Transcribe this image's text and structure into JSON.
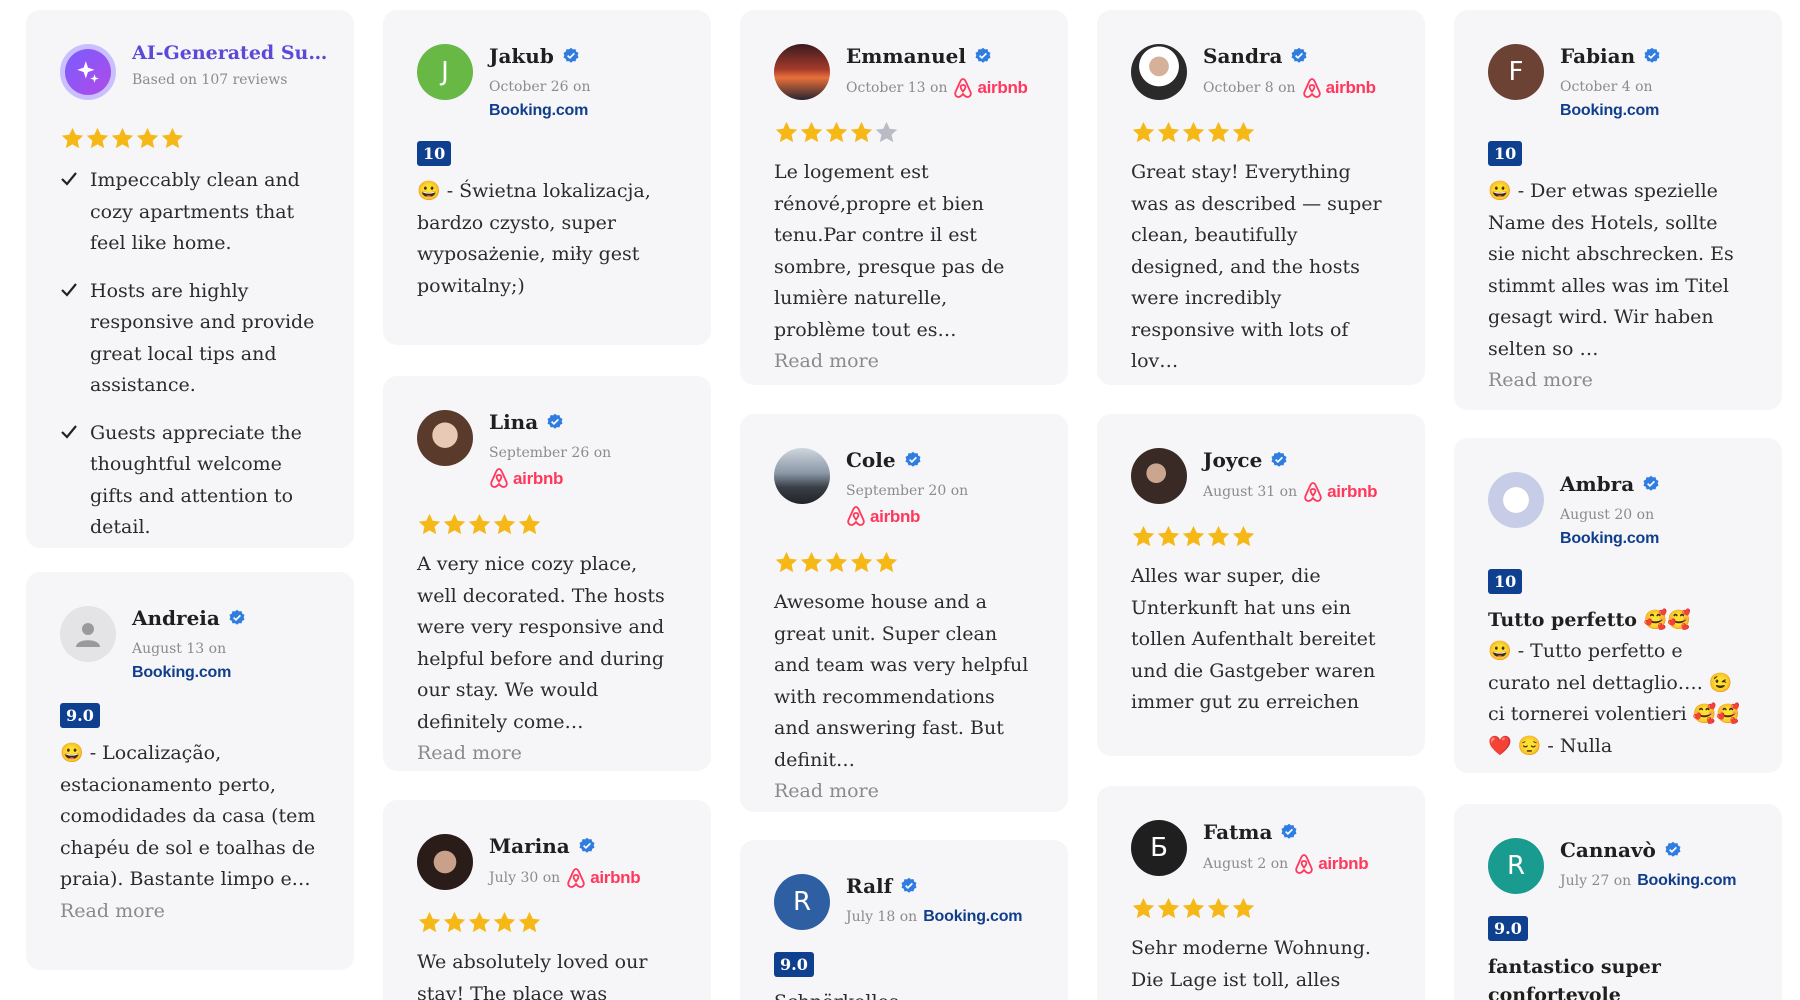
{
  "colors": {
    "star": "#f6b817",
    "star_empty": "#b9bcc4",
    "booking_navy": "#113e8c",
    "airbnb_red": "#ff385c",
    "score_bg": "#0f3f8f",
    "verified_blue": "#2f7de1",
    "ai_purple": "#5b49d8",
    "card_bg": "#f6f6f8"
  },
  "summary": {
    "title": "AI-Generated Summary",
    "subtitle": "Based on 107 reviews",
    "icon": "sparkle-icon",
    "stars": 5,
    "bullets": [
      "Impeccably clean and cozy apartments that feel like home.",
      "Hosts are highly responsive and provide great local tips and assistance.",
      "Guests appreciate the thoughtful welcome gifts and attention to detail."
    ]
  },
  "on_text": "on",
  "read_more": "Read more",
  "booking_logo": {
    "main": "Booking",
    "dot": ".com"
  },
  "airbnb_logo": "airbnb",
  "reviews": {
    "jakub": {
      "name": "Jakub",
      "initial": "J",
      "avatar_color": "#67b845",
      "date": "October 26",
      "source": "booking",
      "score": "10",
      "text": "😀 - Świetna lokalizacja, bardzo czysto, super wyposażenie, miły gest powitalny;)"
    },
    "emmanuel": {
      "name": "Emmanuel",
      "date": "October 13",
      "source": "airbnb",
      "stars": 4,
      "text": "Le logement est rénové,propre et bien tenu.Par contre il est sombre, presque pas de lumière naturelle, problème tout es…"
    },
    "sandra": {
      "name": "Sandra",
      "date": "October 8",
      "source": "airbnb",
      "stars": 5,
      "text": "Great stay! Everything was as described — super clean, beautifully designed, and the hosts were incredibly responsive with lots of lov…"
    },
    "fabian": {
      "name": "Fabian",
      "initial": "F",
      "avatar_color": "#6b4233",
      "date": "October 4",
      "source": "booking",
      "score": "10",
      "text": "😀 - Der etwas spezielle Name des Hotels, sollte sie nicht abschrecken. Es stimmt alles was im Titel gesagt wird. Wir haben selten so …"
    },
    "andreia": {
      "name": "Andreia",
      "date": "August 13",
      "source": "booking",
      "score": "9.0",
      "text": "😀 - Localização, estacionamento perto, comodidades da casa (tem chapéu de sol e toalhas de praia). Bastante limpo e…"
    },
    "lina": {
      "name": "Lina",
      "date": "September 26",
      "source": "airbnb",
      "stars": 5,
      "text": "A very nice cozy place, well decorated. The hosts were very responsive and helpful before and during our stay. We would definitely come…"
    },
    "cole": {
      "name": "Cole",
      "date": "September 20",
      "source": "airbnb",
      "stars": 5,
      "text": "Awesome house and a great unit. Super clean and team was very helpful with recommendations and answering fast. But definit…"
    },
    "joyce": {
      "name": "Joyce",
      "date": "August 31",
      "source": "airbnb",
      "stars": 5,
      "text": "Alles war super, die Unterkunft hat uns ein tollen Aufenthalt bereitet und die Gastgeber waren immer gut zu erreichen"
    },
    "ambra": {
      "name": "Ambra",
      "date": "August 20",
      "source": "booking",
      "score": "10",
      "title": "Tutto perfetto 🥰🥰",
      "text": "😀 - Tutto perfetto e curato nel dettaglio…. 😉ci tornerei volentieri 🥰🥰❤️ 😔 - Nulla"
    },
    "marina": {
      "name": "Marina",
      "date": "July 30",
      "source": "airbnb",
      "stars": 5,
      "text": "We absolutely loved our stay! The place was exactly"
    },
    "ralf": {
      "name": "Ralf",
      "initial": "R",
      "avatar_color": "#2f5fa3",
      "date": "July 18",
      "source": "booking",
      "score": "9.0",
      "text": "Schnörkellos"
    },
    "fatma": {
      "name": "Fatma",
      "initial": "Б",
      "avatar_color": "#1f1f1f",
      "date": "August 2",
      "source": "airbnb",
      "stars": 5,
      "text": "Sehr moderne Wohnung. Die Lage ist toll, alles fußläufig"
    },
    "cannavo": {
      "name": "Cannavò",
      "initial": "R",
      "avatar_color": "#1a9b8f",
      "date": "July 27",
      "source": "booking",
      "score": "9.0",
      "title": "fantastico super confortevole",
      "text": ""
    }
  }
}
